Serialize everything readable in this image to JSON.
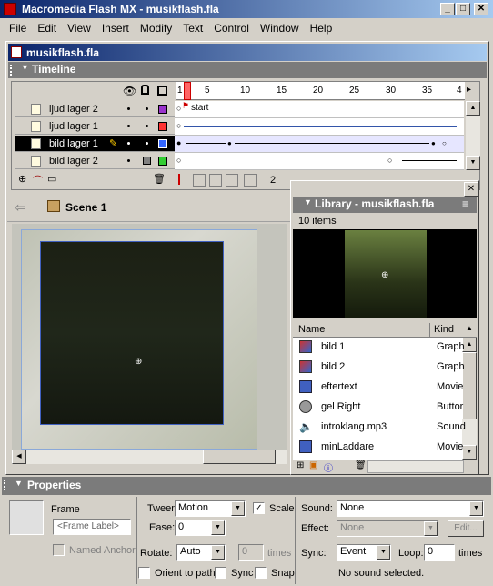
{
  "app": {
    "title": "Macromedia Flash MX - musikflash.fla",
    "menu": [
      "File",
      "Edit",
      "View",
      "Insert",
      "Modify",
      "Text",
      "Control",
      "Window",
      "Help"
    ]
  },
  "document": {
    "title": "musikflash.fla"
  },
  "timeline": {
    "header": "Timeline",
    "ruler": [
      "1",
      "5",
      "10",
      "15",
      "20",
      "25",
      "30",
      "35",
      "4"
    ],
    "layers": [
      {
        "name": "ljud lager 2",
        "color": "#9933cc",
        "locked": false
      },
      {
        "name": "ljud lager 1",
        "color": "#ff3333",
        "locked": false
      },
      {
        "name": "bild lager 1",
        "color": "#3366ff",
        "locked": false
      },
      {
        "name": "bild lager 2",
        "color": "#33cc33",
        "locked": true
      }
    ],
    "frame_label": "start",
    "current_frame": "2"
  },
  "stage": {
    "scene": "Scene 1"
  },
  "library": {
    "title": "Library - musikflash.fla",
    "count": "10 items",
    "col_name": "Name",
    "col_kind": "Kind",
    "items": [
      {
        "name": "bild 1",
        "kind": "Graph",
        "icon": "bitmap-icon"
      },
      {
        "name": "bild 2",
        "kind": "Graph",
        "icon": "bitmap-icon"
      },
      {
        "name": "eftertext",
        "kind": "Movie",
        "icon": "movieclip-icon"
      },
      {
        "name": "gel Right",
        "kind": "Buttor",
        "icon": "button-icon"
      },
      {
        "name": "introklang.mp3",
        "kind": "Sound",
        "icon": "sound-icon"
      },
      {
        "name": "minLaddare",
        "kind": "Movie",
        "icon": "movieclip-icon"
      }
    ]
  },
  "properties": {
    "header": "Properties",
    "frame_title": "Frame",
    "frame_label_placeholder": "<Frame Label>",
    "named_anchor": "Named Anchor",
    "tween_label": "Tween:",
    "tween_value": "Motion",
    "scale_label": "Scale",
    "ease_label": "Ease:",
    "ease_value": "0",
    "rotate_label": "Rotate:",
    "rotate_value": "Auto",
    "rotate_times_value": "0",
    "times_label": "times",
    "orient_label": "Orient to path",
    "sync_check_label": "Sync",
    "snap_label": "Snap",
    "sound_label": "Sound:",
    "sound_value": "None",
    "effect_label": "Effect:",
    "effect_value": "None",
    "edit_label": "Edit...",
    "sync_label": "Sync:",
    "sync_value": "Event",
    "loop_label": "Loop:",
    "loop_value": "0",
    "loop_times": "times",
    "no_sound": "No sound selected."
  }
}
